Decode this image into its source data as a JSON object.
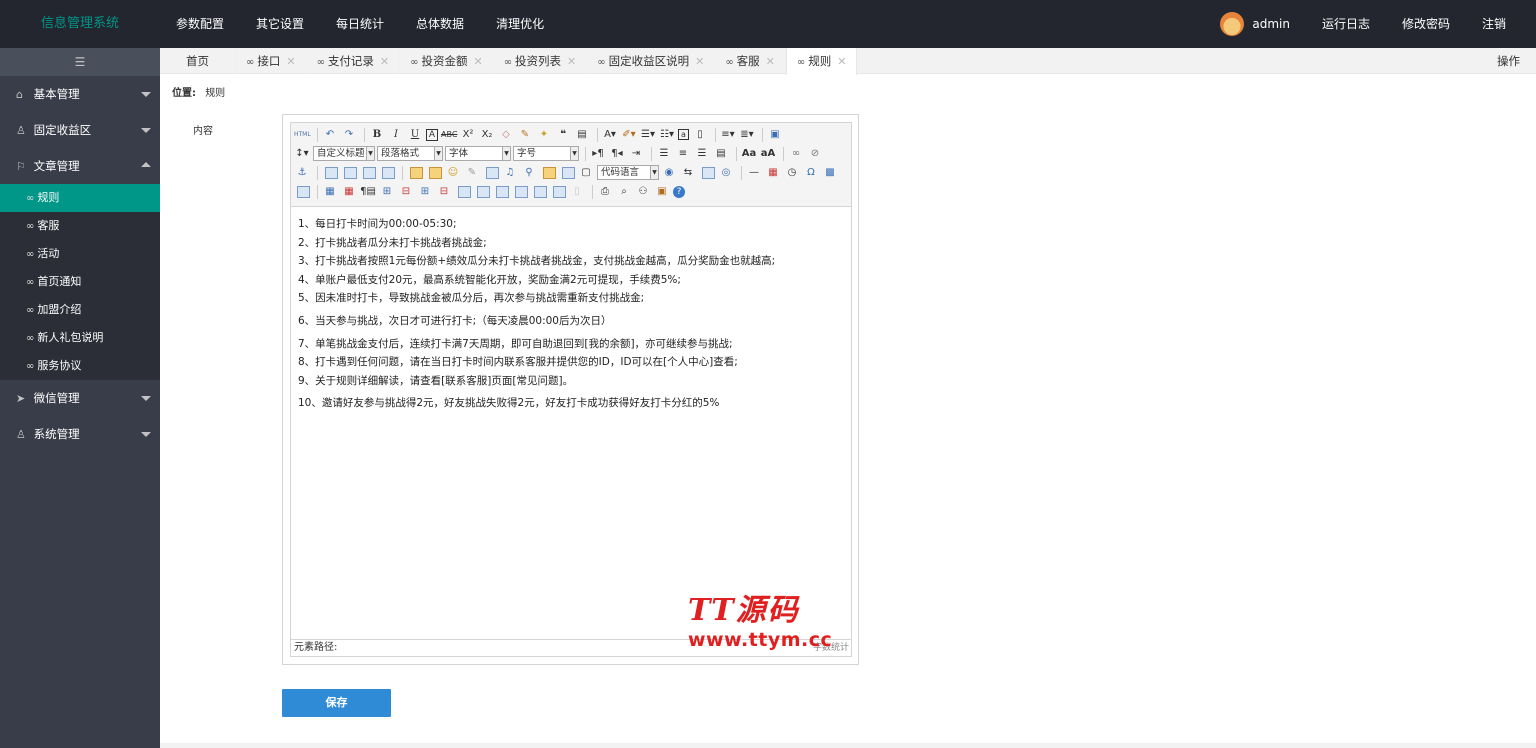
{
  "app": {
    "title": "信息管理系统"
  },
  "topnav": [
    "参数配置",
    "其它设置",
    "每日统计",
    "总体数据",
    "清理优化"
  ],
  "user": {
    "name": "admin"
  },
  "topright": [
    "运行日志",
    "修改密码",
    "注销"
  ],
  "sidebar": {
    "toggle": "☰",
    "groups": [
      {
        "label": "基本管理",
        "icon": "home-icon",
        "glyph": "⌂"
      },
      {
        "label": "固定收益区",
        "icon": "user-icon",
        "glyph": "♙"
      },
      {
        "label": "文章管理",
        "icon": "flag-icon",
        "glyph": "⚐"
      },
      {
        "label": "微信管理",
        "icon": "send-icon",
        "glyph": "➤"
      },
      {
        "label": "系统管理",
        "icon": "user-icon",
        "glyph": "♙"
      }
    ],
    "subitems": [
      "规则",
      "客服",
      "活动",
      "首页通知",
      "加盟介绍",
      "新人礼包说明",
      "服务协议"
    ]
  },
  "tabs": {
    "home": "首页",
    "items": [
      "接口",
      "支付记录",
      "投资金额",
      "投资列表",
      "固定收益区说明",
      "客服",
      "规则"
    ],
    "operation": "操作"
  },
  "breadcrumb": {
    "prefix": "位置:",
    "current": "规则"
  },
  "form": {
    "content_label": "内容",
    "save_label": "保存"
  },
  "toolbar": {
    "custom_title": "自定义标题",
    "paragraph_format": "段落格式",
    "font_family": "字体",
    "font_size": "字号",
    "code_language": "代码语言"
  },
  "editor": {
    "lines": [
      "1、每日打卡时间为00:00-05:30;",
      "2、打卡挑战者瓜分未打卡挑战者挑战金;",
      "3、打卡挑战者按照1元每份额+绩效瓜分未打卡挑战者挑战金，支付挑战金越高，瓜分奖励金也就越高;",
      "4、单账户最低支付20元，最高系统智能化开放，奖励金满2元可提现，手续费5%;",
      "5、因未准时打卡，导致挑战金被瓜分后，再次参与挑战需重新支付挑战金;",
      "6、当天参与挑战，次日才可进行打卡;（每天凌晨00:00后为次日）",
      "7、单笔挑战金支付后，连续打卡满7天周期，即可自助退回到[我的余额]，亦可继续参与挑战;",
      "8、打卡遇到任何问题，请在当日打卡时间内联系客服并提供您的ID，ID可以在[个人中心]查看;",
      "9、关于规则详细解读，请查看[联系客服]页面[常见问题]。",
      "10、邀请好友参与挑战得2元，好友挑战失败得2元，好友打卡成功获得好友打卡分红的5%"
    ],
    "status_path": "元素路径:",
    "word_count": "字数统计"
  },
  "watermark": {
    "line1": "TT源码",
    "line2": "www.ttym.cc"
  },
  "colors": {
    "accent": "#009688",
    "topbar": "#23262e",
    "sidebar": "#393d49",
    "save": "#2f8bd5",
    "watermark": "#e02020"
  }
}
